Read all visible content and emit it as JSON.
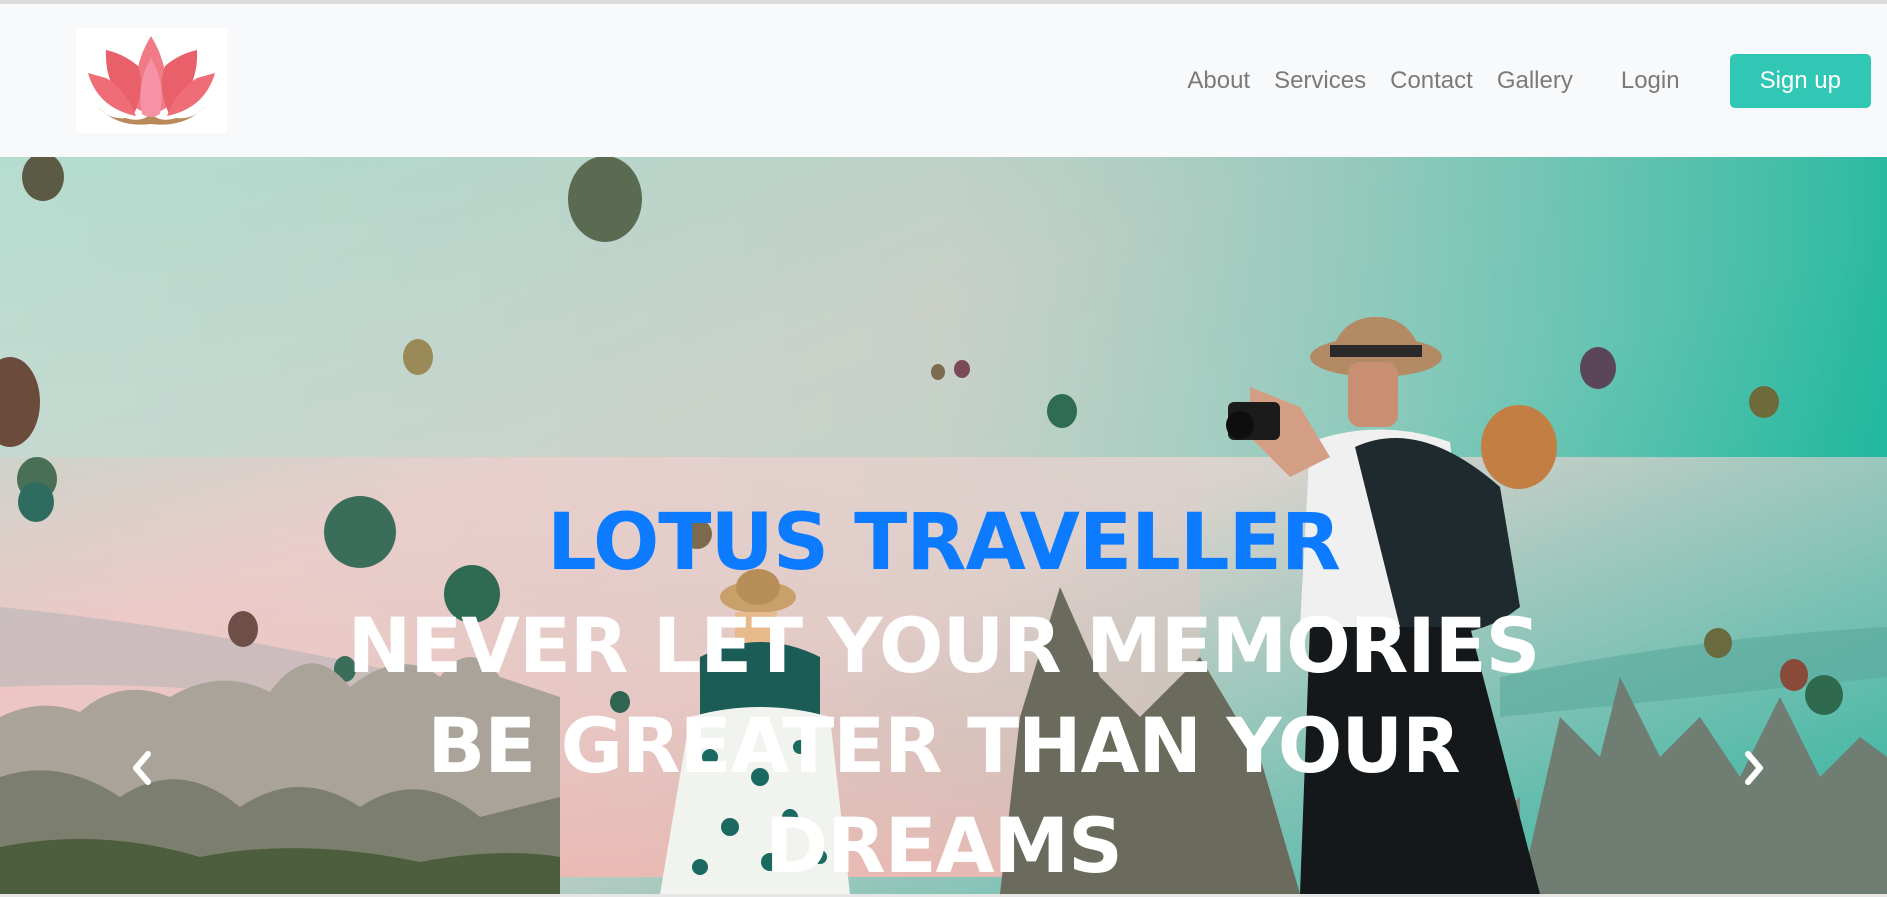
{
  "navbar": {
    "logo_name": "lotus-logo",
    "links": [
      "About",
      "Services",
      "Contact",
      "Gallery"
    ],
    "login_label": "Login",
    "signup_label": "Sign up",
    "signup_color": "#31c7b5",
    "link_color": "#7a7a7a"
  },
  "hero": {
    "title": "LOTUS TRAVELLER",
    "tagline": "NEVER LET YOUR MEMORIES BE GREATER THAN YOUR DREAMS",
    "title_color": "#0d7bff",
    "tagline_color": "#ffffff",
    "prev_icon": "chevron-left-icon",
    "next_icon": "chevron-right-icon"
  }
}
